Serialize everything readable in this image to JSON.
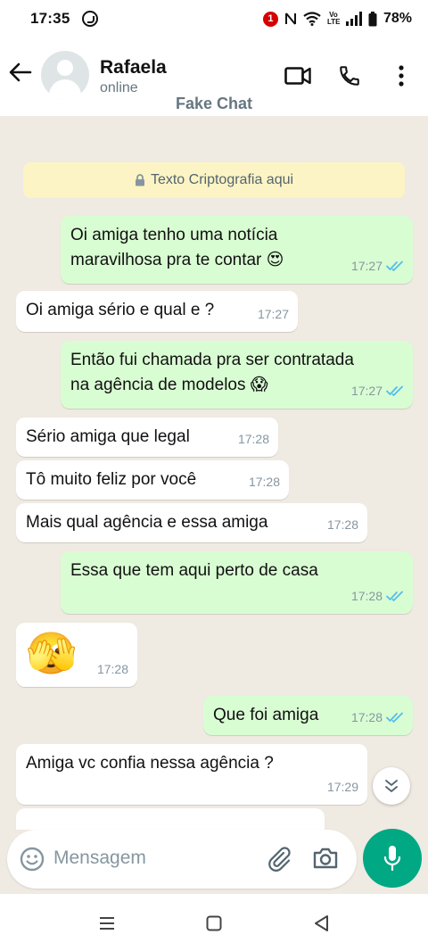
{
  "status_bar": {
    "time": "17:35",
    "notification_count": "1",
    "battery": "78%",
    "network_label": "Vo LTE"
  },
  "header": {
    "contact_name": "Rafaela",
    "contact_status": "online",
    "overlay_title": "Fake Chat"
  },
  "chat": {
    "encryption_note": "Texto Criptografia aqui",
    "messages": [
      {
        "dir": "out",
        "text": "Oi amiga tenho uma notícia\nmaravilhosa pra te contar 😍",
        "time": "17:27",
        "ticks": "read"
      },
      {
        "dir": "in",
        "text": "Oi amiga sério e qual e ?",
        "time": "17:27"
      },
      {
        "dir": "out",
        "text": "Então fui chamada pra ser contratada\nna agência de modelos 😱",
        "time": "17:27",
        "ticks": "read"
      },
      {
        "dir": "in",
        "text": "Sério amiga que legal",
        "time": "17:28"
      },
      {
        "dir": "in",
        "text": "Tô muito feliz por você",
        "time": "17:28"
      },
      {
        "dir": "in",
        "text": "Mais qual agência e essa amiga",
        "time": "17:28"
      },
      {
        "dir": "out",
        "text": "Essa que tem aqui perto de casa",
        "time": "17:28",
        "ticks": "read"
      },
      {
        "dir": "in",
        "text": "🫣",
        "time": "17:28"
      },
      {
        "dir": "out",
        "text": "Que foi amiga",
        "time": "17:28",
        "ticks": "read"
      },
      {
        "dir": "in",
        "text": "Amiga vc confia nessa agência ?",
        "time": "17:29"
      }
    ]
  },
  "composer": {
    "placeholder": "Mensagem"
  },
  "icons": {
    "back": "arrow-left-icon",
    "video": "video-call-icon",
    "call": "phone-icon",
    "menu": "more-vert-icon",
    "emoji": "emoji-icon",
    "attach": "paperclip-icon",
    "camera": "camera-icon",
    "mic": "microphone-icon",
    "scroll": "double-chevron-down-icon"
  },
  "colors": {
    "accent": "#00a884",
    "outgoing_bubble": "#d9fdd3",
    "incoming_bubble": "#ffffff",
    "chat_background": "#efeae2",
    "read_ticks": "#53bdeb",
    "encryption_note_bg": "#fdf4c5"
  }
}
